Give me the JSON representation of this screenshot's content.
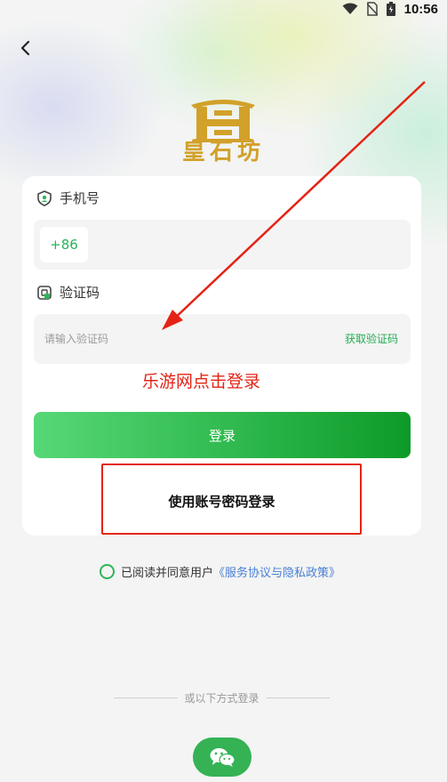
{
  "status_bar": {
    "time": "10:56",
    "icons": [
      "wifi-icon",
      "no-sim-icon",
      "battery-icon"
    ]
  },
  "header": {
    "back_icon": "chevron-left-icon"
  },
  "logo": {
    "brand_text": "皇石坊",
    "color": "#d2a12a"
  },
  "form": {
    "phone": {
      "label": "手机号",
      "country_code": "+86",
      "value": "",
      "placeholder": ""
    },
    "code": {
      "label": "验证码",
      "placeholder": "请输入验证码",
      "get_code_label": "获取验证码"
    },
    "login_label": "登录",
    "password_login_label": "使用账号密码登录"
  },
  "annotation": {
    "text": "乐游网点击登录",
    "color": "#e42316"
  },
  "agreement": {
    "prefix": "已阅读并同意用户",
    "link": "《服务协议与隐私政策》"
  },
  "other_login": {
    "label": "或以下方式登录",
    "wechat_icon": "wechat-icon"
  },
  "colors": {
    "accent": "#2fb55a",
    "link": "#4a7fd6"
  }
}
